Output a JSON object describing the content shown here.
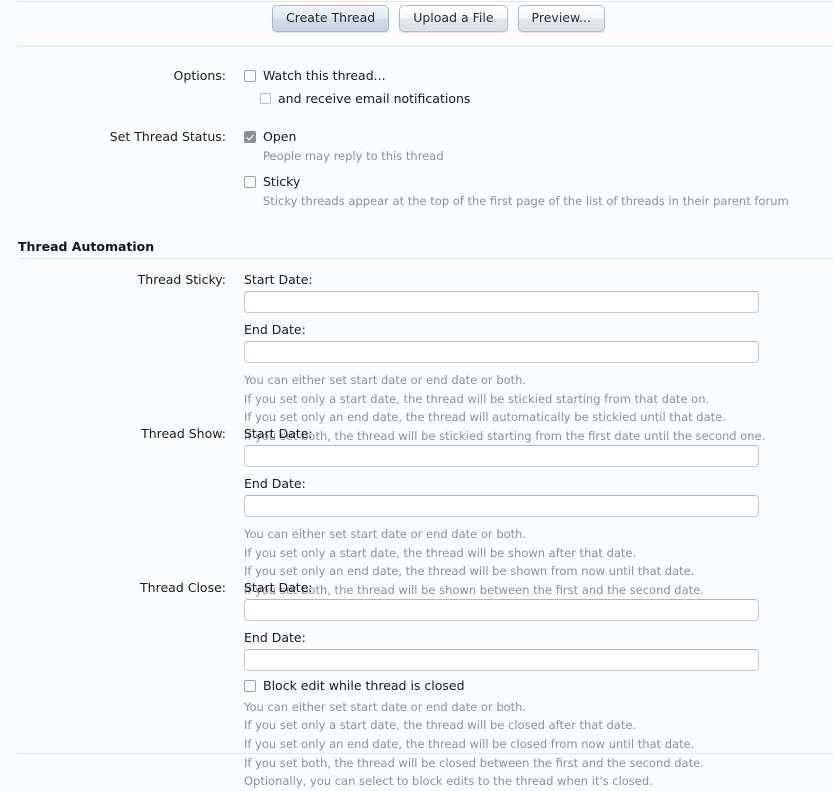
{
  "toolbar": {
    "buttons": [
      {
        "label": "Create Thread",
        "primary": true
      },
      {
        "label": "Upload a File",
        "primary": false
      },
      {
        "label": "Preview...",
        "primary": false
      }
    ]
  },
  "options": {
    "label": "Options:",
    "watch_thread": {
      "label": "Watch this thread...",
      "checked": false
    },
    "email_notifications": {
      "label": "and receive email notifications",
      "checked": false
    }
  },
  "thread_status": {
    "label": "Set Thread Status:",
    "open": {
      "label": "Open",
      "checked": true,
      "hint": "People may reply to this thread"
    },
    "sticky": {
      "label": "Sticky",
      "checked": false,
      "hint": "Sticky threads appear at the top of the first page of the list of threads in their parent forum"
    }
  },
  "automation": {
    "title": "Thread Automation",
    "start_date_label": "Start Date:",
    "end_date_label": "End Date:",
    "sticky": {
      "label": "Thread Sticky:",
      "start_value": "",
      "end_value": "",
      "hints": [
        "You can either set start date or end date or both.",
        "If you set only a start date, the thread will be stickied starting from that date on.",
        "If you set only an end date, the thread will automatically be stickied until that date.",
        "If you set both, the thread will be stickied starting from the first date until the second one."
      ]
    },
    "show": {
      "label": "Thread Show:",
      "start_value": "",
      "end_value": "",
      "hints": [
        "You can either set start date or end date or both.",
        "If you set only a start date, the thread will be shown after that date.",
        "If you set only an end date, the thread will be shown from now until that date.",
        "If you set both, the thread will be shown between the first and the second date."
      ]
    },
    "close": {
      "label": "Thread Close:",
      "start_value": "",
      "end_value": "",
      "block_edit": {
        "label": "Block edit while thread is closed",
        "checked": false
      },
      "hints": [
        "You can either set start date or end date or both.",
        "If you set only a start date, the thread will be closed after that date.",
        "If you set only an end date, the thread will be closed from now until that date.",
        "If you set both, the thread will be closed between the first and the second date.",
        "Optionally, you can select to block edits to the thread when it's closed."
      ]
    }
  }
}
